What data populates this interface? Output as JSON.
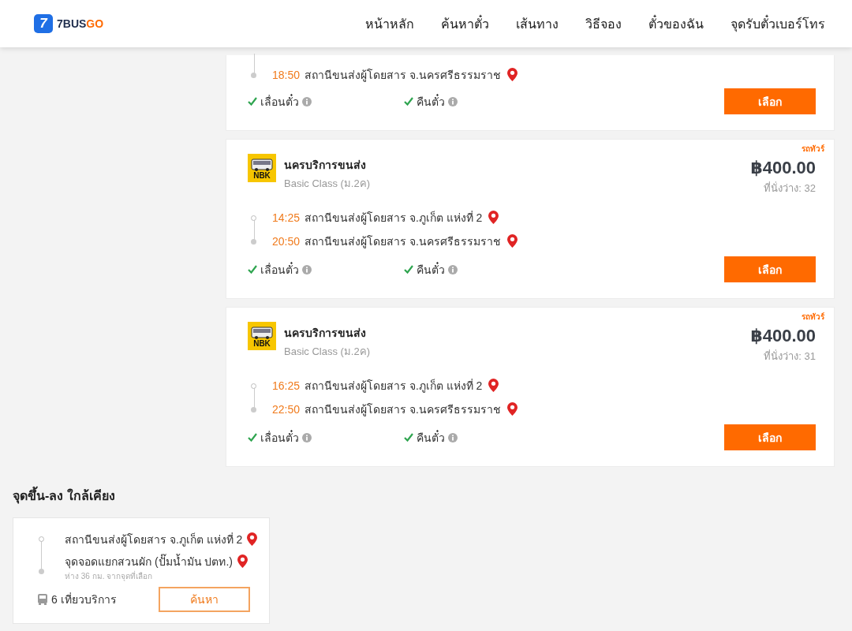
{
  "header": {
    "logo_mark": "7",
    "logo_text": "7BUS",
    "logo_accent": "GO",
    "nav": [
      {
        "label": "หน้าหลัก"
      },
      {
        "label": "ค้นหาตั๋ว"
      },
      {
        "label": "เส้นทาง"
      },
      {
        "label": "วิธีจอง"
      },
      {
        "label": "ตั๋วของฉัน"
      },
      {
        "label": "จุดรับตั๋วเบอร์โทร"
      }
    ]
  },
  "trips": [
    {
      "stops": [
        {
          "kind": "arrival",
          "time": "18:50",
          "station": "สถานีขนส่งผู้โดยสาร จ.นครศรีธรรมราช"
        }
      ],
      "features": [
        {
          "label": "เลื่อนตั๋ว",
          "available": true
        },
        {
          "label": "คืนตั๋ว",
          "available": true
        }
      ],
      "button": "เลือก"
    },
    {
      "tag": "รถทัวร์",
      "operator": "นครบริการขนส่ง",
      "logo_text": "NBK",
      "bus_class": "Basic Class (ม.2ค)",
      "price": "฿400.00",
      "seats": "ที่นั่งว่าง: 32",
      "stops": [
        {
          "kind": "departure",
          "time": "14:25",
          "station": "สถานีขนส่งผู้โดยสาร จ.ภูเก็ต แห่งที่ 2"
        },
        {
          "kind": "arrival",
          "time": "20:50",
          "station": "สถานีขนส่งผู้โดยสาร จ.นครศรีธรรมราช"
        }
      ],
      "features": [
        {
          "label": "เลื่อนตั๋ว",
          "available": true
        },
        {
          "label": "คืนตั๋ว",
          "available": true
        }
      ],
      "button": "เลือก"
    },
    {
      "tag": "รถทัวร์",
      "operator": "นครบริการขนส่ง",
      "logo_text": "NBK",
      "bus_class": "Basic Class (ม.2ค)",
      "price": "฿400.00",
      "seats": "ที่นั่งว่าง: 31",
      "stops": [
        {
          "kind": "departure",
          "time": "16:25",
          "station": "สถานีขนส่งผู้โดยสาร จ.ภูเก็ต แห่งที่ 2"
        },
        {
          "kind": "arrival",
          "time": "22:50",
          "station": "สถานีขนส่งผู้โดยสาร จ.นครศรีธรรมราช"
        }
      ],
      "features": [
        {
          "label": "เลื่อนตั๋ว",
          "available": true
        },
        {
          "label": "คืนตั๋ว",
          "available": true
        }
      ],
      "button": "เลือก"
    }
  ],
  "nearby": {
    "title": "จุดขึ้น-ลง ใกล้เคียง",
    "stops": [
      {
        "kind": "departure",
        "name": "สถานีขนส่งผู้โดยสาร จ.ภูเก็ต แห่งที่ 2"
      },
      {
        "kind": "arrival",
        "name": "จุดจอดแยกสวนผัก (ปั๊มน้ำมัน ปตท.)",
        "note": "ห่าง 36 กม. จากจุดที่เลือก"
      }
    ],
    "trips_count": "6 เที่ยวบริการ",
    "button": "ค้นหา"
  }
}
